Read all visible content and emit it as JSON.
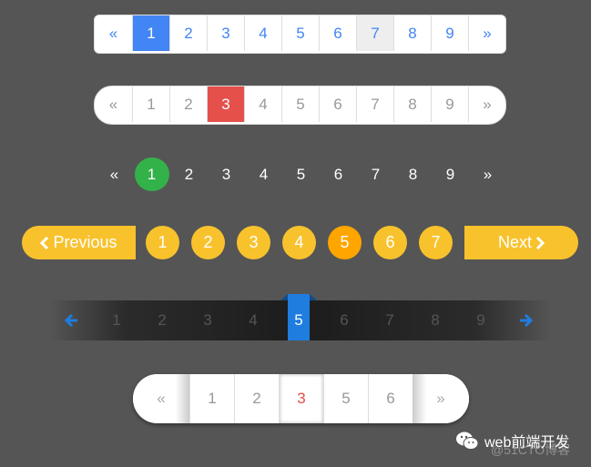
{
  "colors": {
    "background": "#555555",
    "blue": "#4285f4",
    "red": "#e5504b",
    "green": "#34b24a",
    "yellow": "#f8c22d",
    "orange": "#ffa500",
    "dark_blue": "#1f7de0"
  },
  "pager1": {
    "prev": "«",
    "next": "»",
    "pages": [
      "1",
      "2",
      "3",
      "4",
      "5",
      "6",
      "7",
      "8",
      "9"
    ],
    "active": "1",
    "disabled": "7"
  },
  "pager2": {
    "prev": "«",
    "next": "»",
    "pages": [
      "1",
      "2",
      "3",
      "4",
      "5",
      "6",
      "7",
      "8",
      "9"
    ],
    "active": "3"
  },
  "pager3": {
    "prev": "«",
    "next": "»",
    "pages": [
      "1",
      "2",
      "3",
      "4",
      "5",
      "6",
      "7",
      "8",
      "9"
    ],
    "active": "1"
  },
  "pager4": {
    "prev": "Previous",
    "next": "Next",
    "prev_icon": "chevron-left-icon",
    "next_icon": "chevron-right-icon",
    "pages": [
      "1",
      "2",
      "3",
      "4",
      "5",
      "6",
      "7"
    ],
    "active": "5"
  },
  "pager5": {
    "prev_icon": "arrow-left-icon",
    "next_icon": "arrow-right-icon",
    "pages": [
      "1",
      "2",
      "3",
      "4",
      "5",
      "6",
      "7",
      "8",
      "9"
    ],
    "active": "5"
  },
  "pager6": {
    "prev": "«",
    "next": "»",
    "pages": [
      "1",
      "2",
      "3",
      "5",
      "6"
    ],
    "active": "3"
  },
  "watermark": {
    "icon": "wechat-icon",
    "text": "web前端开发",
    "sub": "@51CTO博客"
  }
}
